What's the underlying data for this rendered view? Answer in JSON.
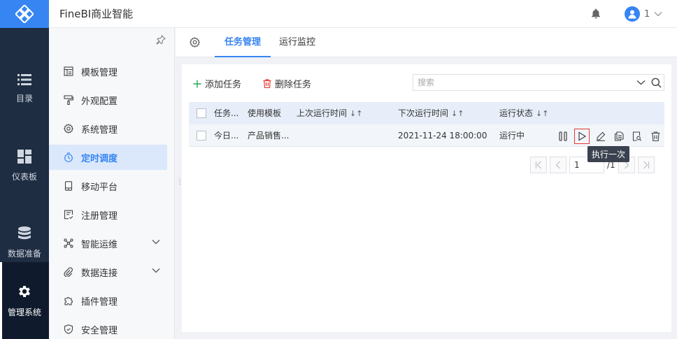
{
  "app": {
    "title": "FineBI商业智能"
  },
  "header": {
    "user_name": "1"
  },
  "rail": [
    {
      "label": "目录",
      "icon": "list-icon"
    },
    {
      "label": "仪表板",
      "icon": "dashboard-icon"
    },
    {
      "label": "数据准备",
      "icon": "database-icon"
    },
    {
      "label": "管理系统",
      "icon": "gear-icon",
      "active": true
    }
  ],
  "subnav": [
    {
      "label": "模板管理",
      "icon": "template-icon"
    },
    {
      "label": "外观配置",
      "icon": "paint-icon"
    },
    {
      "label": "系统管理",
      "icon": "settings-icon"
    },
    {
      "label": "定时调度",
      "icon": "timer-icon",
      "active": true
    },
    {
      "label": "移动平台",
      "icon": "mobile-icon"
    },
    {
      "label": "注册管理",
      "icon": "register-icon"
    },
    {
      "label": "智能运维",
      "icon": "ops-icon",
      "expandable": true
    },
    {
      "label": "数据连接",
      "icon": "link-icon",
      "expandable": true
    },
    {
      "label": "插件管理",
      "icon": "plugin-icon"
    },
    {
      "label": "安全管理",
      "icon": "shield-icon"
    }
  ],
  "tabs": [
    {
      "label": "任务管理",
      "active": true
    },
    {
      "label": "运行监控",
      "active": false
    }
  ],
  "toolbar": {
    "add_label": "添加任务",
    "delete_label": "删除任务",
    "search_placeholder": "搜索"
  },
  "table": {
    "columns": {
      "task": "任务...",
      "template": "使用模板",
      "last_run": "上次运行时间",
      "next_run": "下次运行时间",
      "status": "运行状态"
    },
    "rows": [
      {
        "task": "今日...",
        "template": "产品销售...",
        "last_run": "",
        "next_run": "2021-11-24 18:00:00",
        "status": "运行中"
      }
    ]
  },
  "tooltip": "执行一次",
  "pagination": {
    "current_page": "1",
    "total": "/1"
  },
  "colors": {
    "accent": "#3685f2",
    "rail_bg": "#1e2d42",
    "danger": "#e53935"
  }
}
